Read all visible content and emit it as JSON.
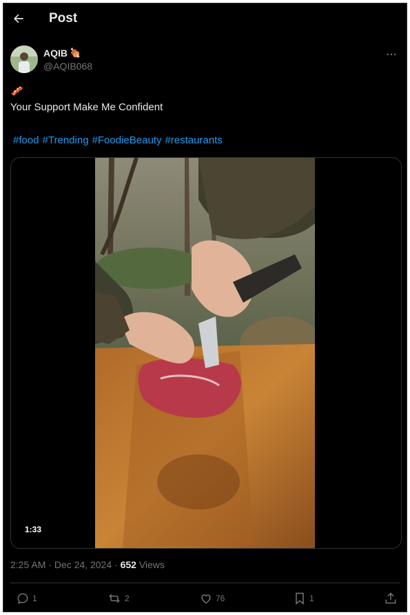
{
  "header": {
    "title": "Post",
    "back_icon": "arrow-left-icon"
  },
  "author": {
    "name": "AQIB",
    "name_emoji": "🍖",
    "handle": "@AQIB068"
  },
  "post": {
    "emoji_line": "🥓",
    "text": "Your Support Make Me Confident",
    "hashtags": [
      "#food",
      "#Trending",
      "#FoodieBeauty",
      "#restaurants"
    ]
  },
  "media": {
    "duration": "1:33"
  },
  "meta": {
    "time": "2:25 AM",
    "date": "Dec 24, 2024",
    "views_count": "652",
    "views_label": "Views",
    "sep": "·"
  },
  "actions": {
    "replies": "1",
    "reposts": "2",
    "likes": "76",
    "bookmarks": "1"
  },
  "colors": {
    "accent": "#1d9bf0",
    "background": "#000000",
    "secondary_text": "#71767b"
  }
}
